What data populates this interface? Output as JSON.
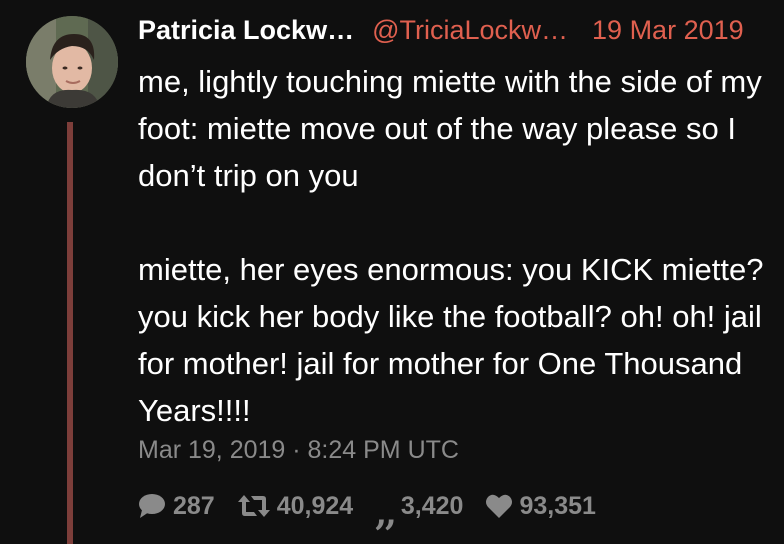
{
  "author": {
    "fullname": "Patricia Lockw…",
    "username": "@TriciaLockw…",
    "date": "19 Mar 2019"
  },
  "tweet": {
    "paragraphs": [
      "me, lightly touching miette with the side of my foot: miette move out of the way please so I don’t trip on you",
      "miette, her eyes enormous: you KICK miette? you kick her body like the football? oh! oh! jail for mother! jail for mother for One Thousand Years!!!!"
    ],
    "published": "Mar 19, 2019 · 8:24 PM UTC"
  },
  "stats": {
    "replies": "287",
    "retweets": "40,924",
    "quotes": "3,420",
    "likes": "93,351"
  },
  "icons": {
    "replies": "comment-icon",
    "retweets": "retweet-icon",
    "quotes": "quote-icon",
    "likes": "heart-icon"
  },
  "colors": {
    "background": "#0f0f0f",
    "text": "#ffffff",
    "accent": "#e0604f",
    "muted": "#8a8a8a",
    "thread_line": "#7d3e3a"
  }
}
